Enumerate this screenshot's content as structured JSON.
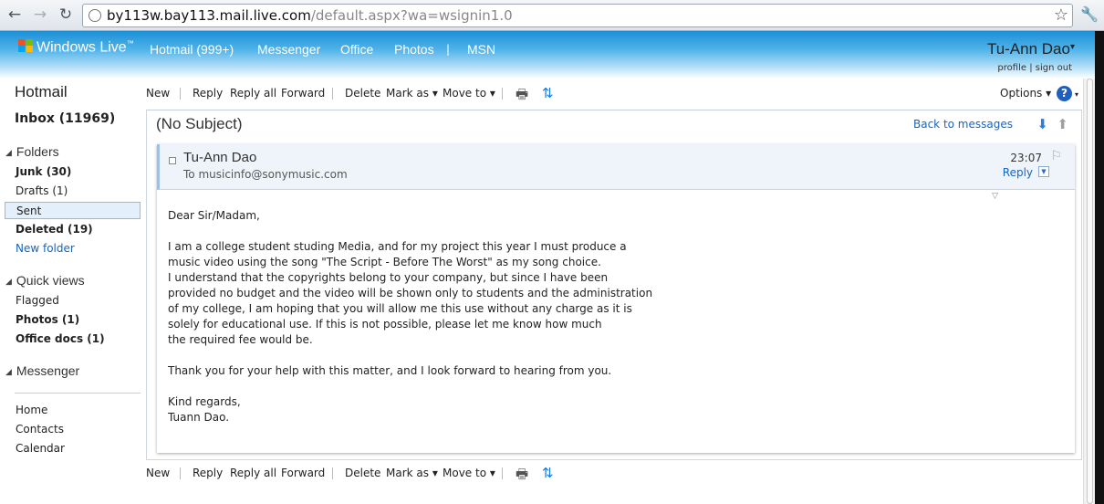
{
  "browser": {
    "url_host": "by113w.bay113.mail.live.com",
    "url_path": "/default.aspx?wa=wsignin1.0"
  },
  "header": {
    "logo": "Windows Live",
    "logo_tm": "™",
    "nav": [
      "Hotmail (999+)",
      "Messenger",
      "Office",
      "Photos",
      "MSN"
    ],
    "separator": "|",
    "user_name": "Tu-Ann Dao",
    "user_caret": "▾",
    "profile": "profile",
    "link_sep": "|",
    "sign_out": "sign out"
  },
  "sidebar": {
    "title": "Hotmail",
    "inbox": "Inbox (11969)",
    "folders_head": "Folders",
    "folders": [
      {
        "label": "Junk (30)"
      },
      {
        "label": "Drafts (1)"
      },
      {
        "label": "Sent"
      },
      {
        "label": "Deleted (19)"
      },
      {
        "label": "New folder"
      }
    ],
    "quick_views_head": "Quick views",
    "quick_views": [
      {
        "label": "Flagged"
      },
      {
        "label": "Photos (1)"
      },
      {
        "label": "Office docs (1)"
      }
    ],
    "messenger_head": "Messenger",
    "footer_links": [
      {
        "label": "Home"
      },
      {
        "label": "Contacts"
      },
      {
        "label": "Calendar"
      }
    ]
  },
  "toolbar": {
    "new": "New",
    "reply": "Reply",
    "reply_all": "Reply all",
    "forward": "Forward",
    "delete": "Delete",
    "mark_as": "Mark as ▾",
    "move_to": "Move to ▾",
    "options": "Options ▾",
    "help": "?"
  },
  "message": {
    "subject": "(No Subject)",
    "back_link": "Back to messages",
    "sender": "Tu-Ann Dao",
    "recipient": "To musicinfo@sonymusic.com",
    "time": "23:07",
    "reply": "Reply",
    "body": {
      "greeting": "Dear Sir/Madam,",
      "para1": [
        "I am a college student studing Media, and for my project this year I must produce a",
        "music video using the song \"The Script - Before The Worst\" as my song choice.",
        "I understand that the copyrights belong to your company, but since I have been",
        "provided no budget and the video will be shown only to students and the administration",
        "of my college, I am hoping that you will allow me this use without any charge as it is",
        "solely for educational use. If this is not possible, please let me know how much",
        "the required fee would be."
      ],
      "para2": "Thank you for your help with this matter, and I look forward to hearing from you.",
      "closing": "Kind regards,",
      "signature": "Tuann Dao."
    }
  },
  "icons": {
    "back": "back-arrow-icon",
    "forward": "forward-arrow-icon",
    "reload": "reload-icon",
    "star": "star-icon",
    "wrench": "wrench-icon",
    "print": "printer-icon",
    "sync": "sync-icon"
  },
  "colors": {
    "accent": "#1565c0",
    "header_top": "#1b8fd6",
    "selected_bg": "#e3f0fb"
  }
}
